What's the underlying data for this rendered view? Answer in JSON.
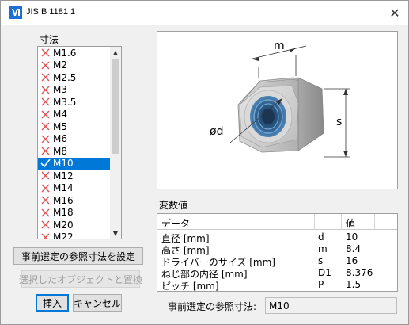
{
  "window": {
    "title": "JIS B 1181 1",
    "close_glyph": "✕"
  },
  "dimensions": {
    "label": "寸法",
    "items": [
      {
        "label": "M1.6",
        "status": "unavailable"
      },
      {
        "label": "M2",
        "status": "unavailable"
      },
      {
        "label": "M2.5",
        "status": "unavailable"
      },
      {
        "label": "M3",
        "status": "unavailable"
      },
      {
        "label": "M3.5",
        "status": "unavailable"
      },
      {
        "label": "M4",
        "status": "unavailable"
      },
      {
        "label": "M5",
        "status": "unavailable"
      },
      {
        "label": "M6",
        "status": "unavailable"
      },
      {
        "label": "M8",
        "status": "unavailable"
      },
      {
        "label": "M10",
        "status": "available",
        "selected": true
      },
      {
        "label": "M12",
        "status": "unavailable"
      },
      {
        "label": "M14",
        "status": "unavailable"
      },
      {
        "label": "M16",
        "status": "unavailable"
      },
      {
        "label": "M18",
        "status": "unavailable"
      },
      {
        "label": "M20",
        "status": "unavailable"
      },
      {
        "label": "M22",
        "status": "unavailable"
      }
    ]
  },
  "buttons": {
    "set_preselected": "事前選定の参照寸法を設定",
    "replace_selected": "選択したオブジェクトと置換",
    "insert": "挿入",
    "cancel": "キャンセル"
  },
  "diagram": {
    "label_m": "m",
    "label_s": "s",
    "label_d": "ød"
  },
  "variables": {
    "label": "変数値",
    "columns": [
      "データ",
      "",
      "値"
    ],
    "rows": [
      {
        "name": "直径 [mm]",
        "symbol": "d",
        "value": "10"
      },
      {
        "name": "高さ [mm]",
        "symbol": "m",
        "value": "8.4"
      },
      {
        "name": "ドライバーのサイズ [mm]",
        "symbol": "s",
        "value": "16"
      },
      {
        "name": "ねじ部の内径 [mm]",
        "symbol": "D1",
        "value": "8.376"
      },
      {
        "name": "ピッチ [mm]",
        "symbol": "P",
        "value": "1.5"
      }
    ]
  },
  "reference": {
    "label": "事前選定の参照寸法:",
    "value": "M10"
  },
  "colors": {
    "selection": "#0078d7",
    "unavailable_mark": "#e05050",
    "available_mark": "#2e9e2e"
  }
}
